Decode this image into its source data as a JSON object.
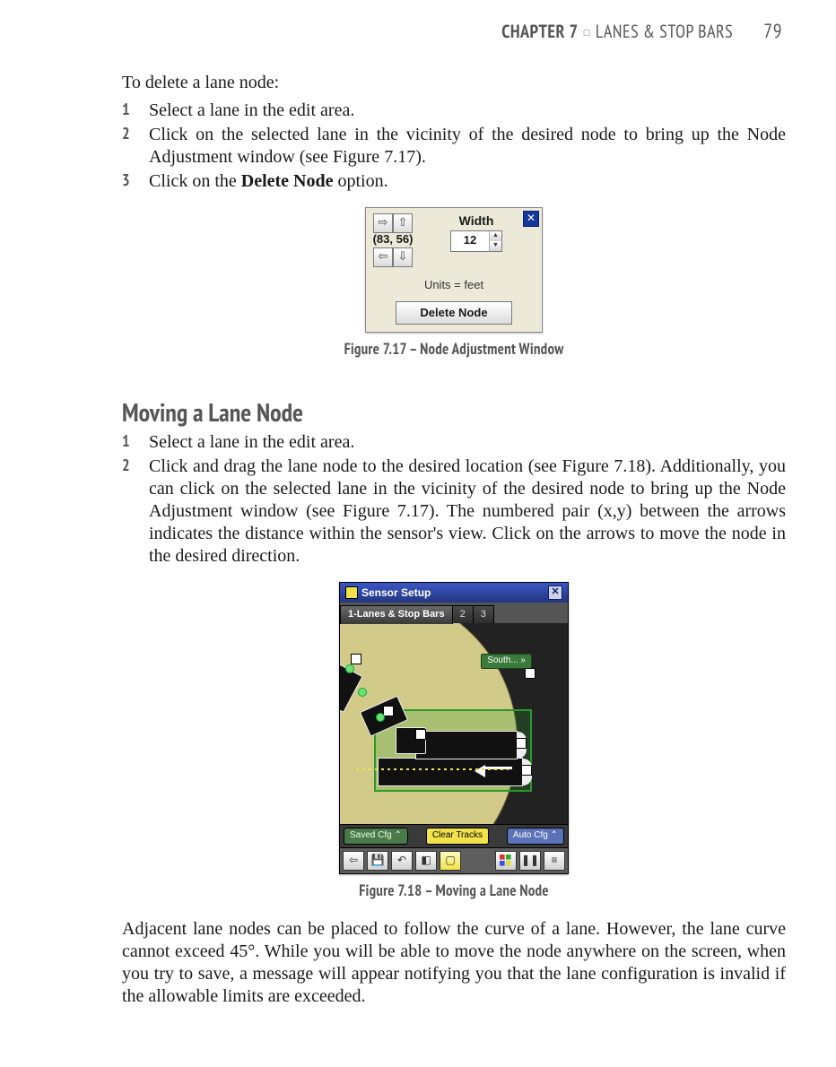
{
  "header": {
    "chapter": "CHAPTER 7",
    "title": "LANES & STOP BARS",
    "page": "79"
  },
  "intro": "To delete a lane node:",
  "delete_steps": [
    "Select a lane in the edit area.",
    "Click on the selected lane in the vicinity of the desired node to bring up the Node Adjustment window (see Figure 7.17).",
    "Click on the Delete Node option."
  ],
  "fig717_caption": "Figure 7.17 – Node Adjustment Window",
  "naw": {
    "coord": "(83, 56)",
    "width_label": "Width",
    "width_value": "12",
    "units": "Units = feet",
    "delete_btn": "Delete Node"
  },
  "section_heading": "Moving a Lane Node",
  "move_steps_1": "Select a lane in the edit area.",
  "move_steps_2": "Click and drag the lane node to the desired location (see Figure 7.18). Additionally, you can click on the selected lane in the vicinity of the desired node to bring up the Node Adjustment window (see Figure 7.17). The numbered pair (x,y) between the arrows indicates the distance within the sensor's view. Click on the arrows to move the node in the desired direction.",
  "fig718_caption": "Figure 7.18 – Moving a Lane Node",
  "ss": {
    "title": "Sensor Setup",
    "tab_main": "1-Lanes & Stop Bars",
    "tab2": "2",
    "tab3": "3",
    "south": "South...",
    "saved": "Saved Cfg",
    "clear": "Clear Tracks",
    "auto": "Auto Cfg"
  },
  "closing": "Adjacent lane nodes can be placed to follow the curve of a lane. However, the lane curve cannot exceed 45°. While you will be able to move the node anywhere on the screen, when you try to save, a message will appear notifying you that the lane configuration is invalid if the allowable limits are exceeded."
}
